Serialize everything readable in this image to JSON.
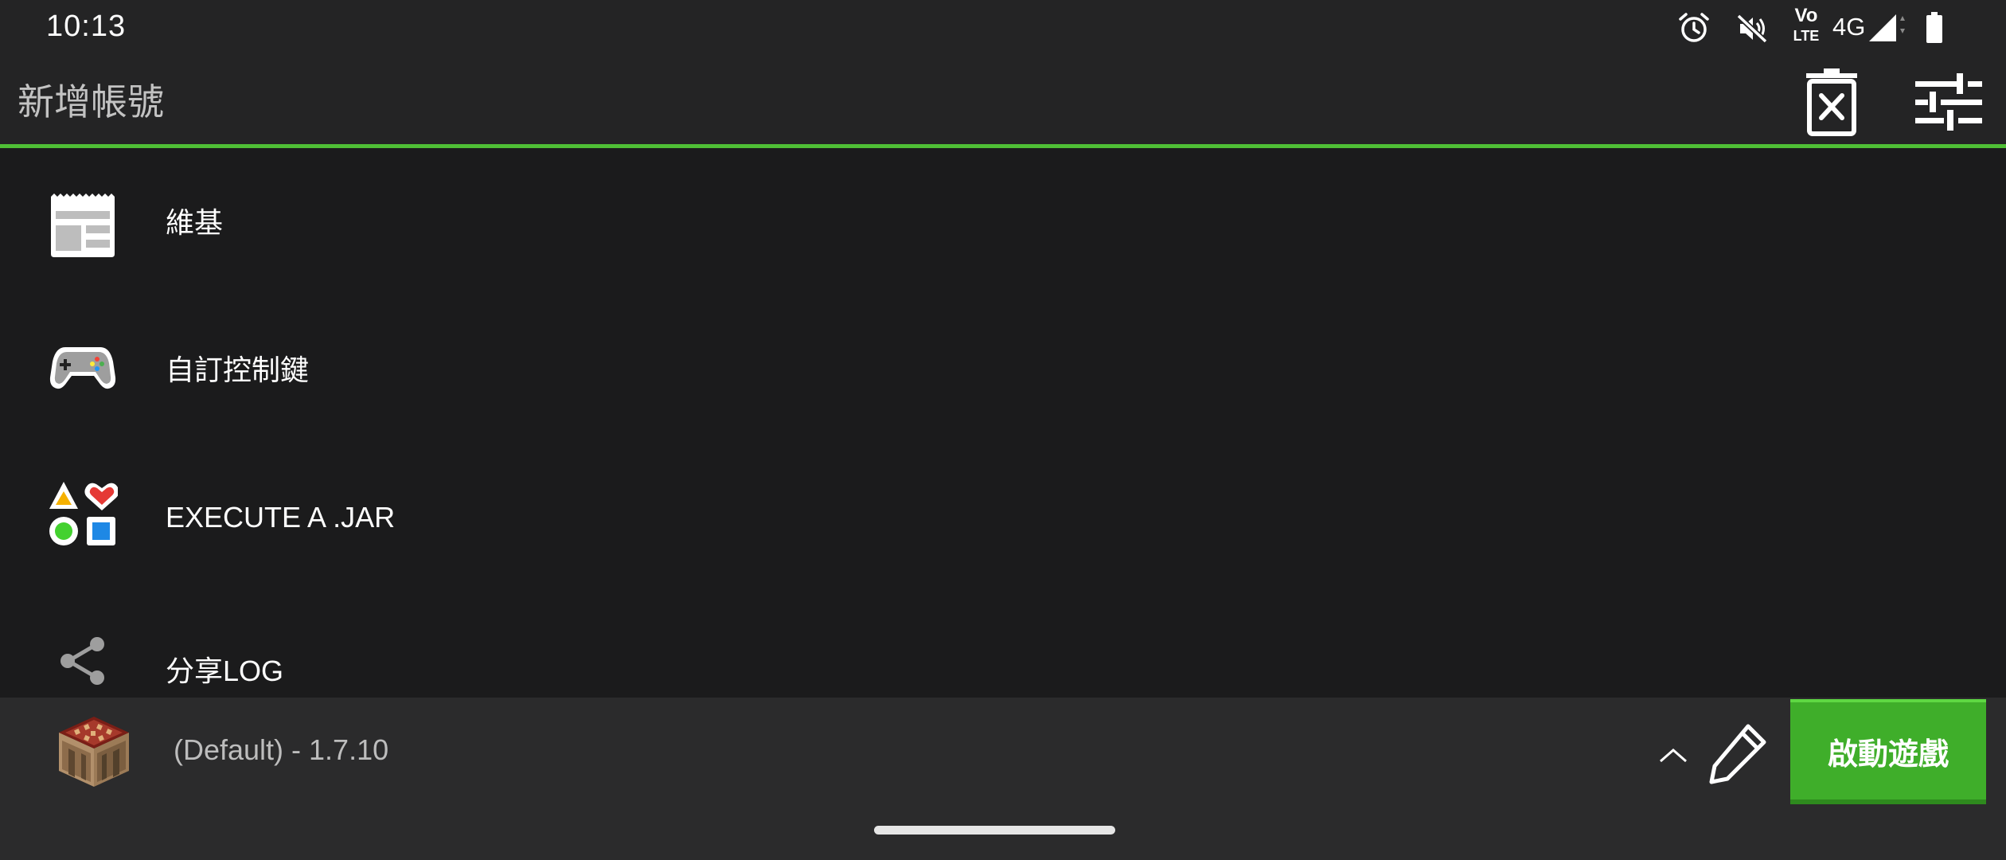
{
  "status_bar": {
    "time": "10:13",
    "volte_top": "Vo",
    "volte_bottom": "LTE",
    "network": "4G",
    "icons": [
      "alarm-icon",
      "mute-icon",
      "volte-icon",
      "signal-icon",
      "battery-icon"
    ]
  },
  "header": {
    "title": "新增帳號",
    "actions": [
      "delete-account-icon",
      "settings-sliders-icon"
    ],
    "accent_color": "#4fbf36"
  },
  "menu": {
    "items": [
      {
        "label": "維基",
        "icon": "wiki-news-icon"
      },
      {
        "label": "自訂控制鍵",
        "icon": "gamepad-icon"
      },
      {
        "label": "EXECUTE A .JAR",
        "icon": "shapes-icon"
      },
      {
        "label": "分享LOG",
        "icon": "share-icon"
      }
    ]
  },
  "bottom_bar": {
    "version_label": "(Default) - 1.7.10",
    "version_icon": "crafting-block-icon",
    "launch_label": "啟動遊戲",
    "launch_color": "#3fae2a"
  }
}
